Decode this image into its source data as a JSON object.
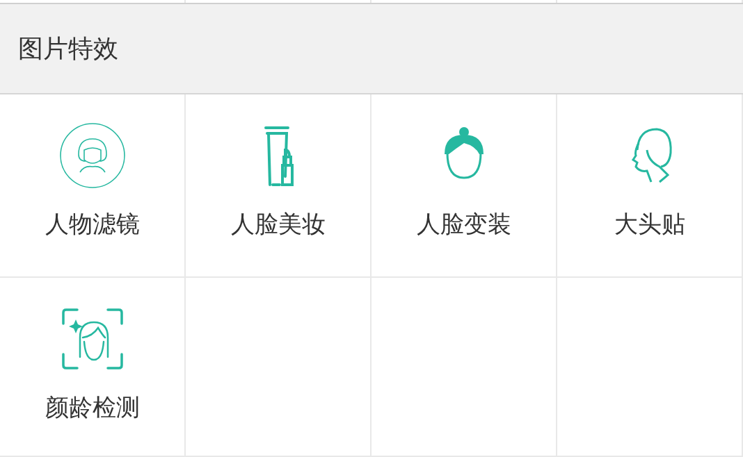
{
  "section": {
    "title": "图片特效"
  },
  "tools": [
    {
      "label": "人物滤镜",
      "kind": "filter"
    },
    {
      "label": "人脸美妆",
      "kind": "makeup"
    },
    {
      "label": "人脸变装",
      "kind": "dressup"
    },
    {
      "label": "大头贴",
      "kind": "sticker"
    },
    {
      "label": "颜龄检测",
      "kind": "age"
    }
  ]
}
